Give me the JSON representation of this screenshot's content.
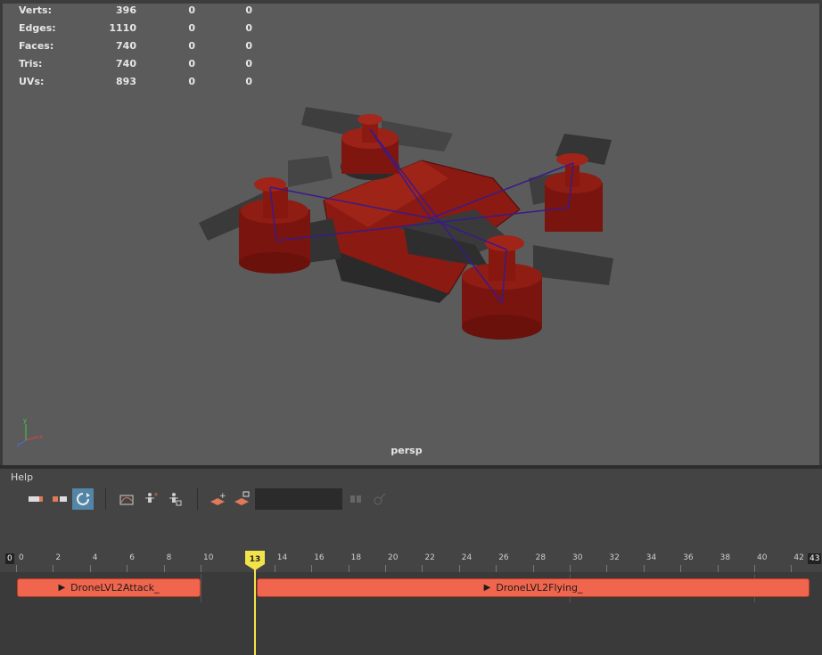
{
  "hud": {
    "rows": [
      {
        "label": "Verts:",
        "v1": "396",
        "v2": "0",
        "v3": "0"
      },
      {
        "label": "Edges:",
        "v1": "1110",
        "v2": "0",
        "v3": "0"
      },
      {
        "label": "Faces:",
        "v1": "740",
        "v2": "0",
        "v3": "0"
      },
      {
        "label": "Tris:",
        "v1": "740",
        "v2": "0",
        "v3": "0"
      },
      {
        "label": "UVs:",
        "v1": "893",
        "v2": "0",
        "v3": "0"
      }
    ]
  },
  "viewport": {
    "camera": "persp",
    "axis_x": "x",
    "axis_y": "y",
    "axis_z": "z"
  },
  "colors": {
    "clip": "#f0654d",
    "cursor": "#f2e34b",
    "active_tool": "#5285a6",
    "drone_red": "#7a1410",
    "drone_gray": "#3b3b3b"
  },
  "menu": {
    "help": "Help"
  },
  "timeline": {
    "start": "0",
    "end": "43",
    "current": "13",
    "ticks": [
      "0",
      "2",
      "4",
      "6",
      "8",
      "10",
      "14",
      "16",
      "18",
      "20",
      "22",
      "24",
      "26",
      "28",
      "30",
      "32",
      "34",
      "36",
      "38",
      "40",
      "42"
    ],
    "clips": [
      {
        "name": "DroneLVL2Attack_",
        "start": 0,
        "end": 10
      },
      {
        "name": "DroneLVL2Flying_",
        "start": 13,
        "end": 43
      }
    ]
  }
}
